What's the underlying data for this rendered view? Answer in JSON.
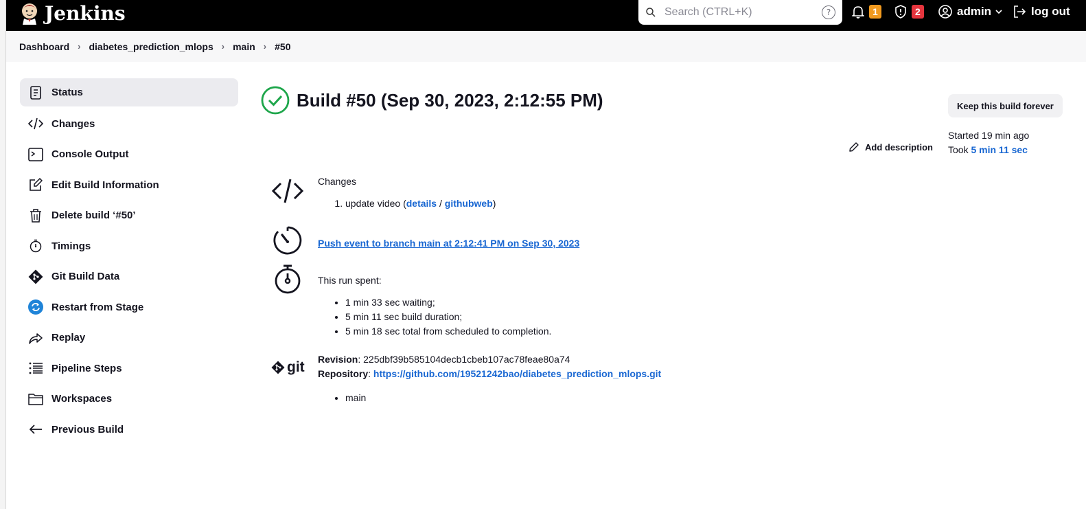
{
  "header": {
    "app_name": "Jenkins",
    "search_placeholder": "Search (CTRL+K)",
    "notifications_count": "1",
    "security_count": "2",
    "user": "admin",
    "logout": "log out",
    "help_glyph": "?"
  },
  "breadcrumb": [
    "Dashboard",
    "diabetes_prediction_mlops",
    "main",
    "#50"
  ],
  "sidebar": {
    "items": [
      {
        "label": "Status",
        "icon": "status-icon"
      },
      {
        "label": "Changes",
        "icon": "code-icon"
      },
      {
        "label": "Console Output",
        "icon": "terminal-icon"
      },
      {
        "label": "Edit Build Information",
        "icon": "edit-icon"
      },
      {
        "label": "Delete build ‘#50’",
        "icon": "trash-icon"
      },
      {
        "label": "Timings",
        "icon": "stopwatch-icon"
      },
      {
        "label": "Git Build Data",
        "icon": "git-icon"
      },
      {
        "label": "Restart from Stage",
        "icon": "restart-icon"
      },
      {
        "label": "Replay",
        "icon": "replay-icon"
      },
      {
        "label": "Pipeline Steps",
        "icon": "list-icon"
      },
      {
        "label": "Workspaces",
        "icon": "folder-icon"
      },
      {
        "label": "Previous Build",
        "icon": "arrow-left-icon"
      }
    ]
  },
  "build": {
    "title": "Build #50 (Sep 30, 2023, 2:12:55 PM)",
    "keep_forever": "Keep this build forever",
    "add_description": "Add description",
    "started": "Started 19 min ago",
    "took_label": "Took",
    "took_value": "5 min 11 sec"
  },
  "changes": {
    "heading": "Changes",
    "item_text": "update video (",
    "details": "details",
    "slash": " / ",
    "githubweb": "githubweb",
    "close": ")"
  },
  "trigger": {
    "text": "Push event to branch main at 2:12:41 PM on Sep 30, 2023"
  },
  "timing": {
    "heading": "This run spent:",
    "items": [
      "1 min 33 sec waiting;",
      "5 min 11 sec build duration;",
      "5 min 18 sec total from scheduled to completion."
    ]
  },
  "git": {
    "logo_text": "git",
    "revision_label": "Revision",
    "revision": "225dbf39b585104decb1cbeb107ac78feae80a74",
    "repository_label": "Repository",
    "repository": "https://github.com/19521242bao/diabetes_prediction_mlops.git",
    "branches": [
      "main"
    ]
  },
  "colors": {
    "success": "#1ea64b",
    "link": "#1967d2",
    "badge_orange": "#f19a1f",
    "badge_red": "#e6353e"
  }
}
